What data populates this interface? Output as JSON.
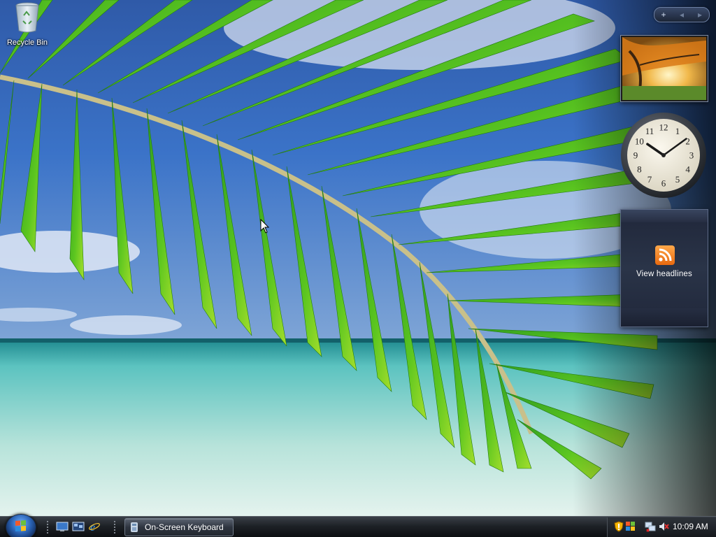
{
  "desktop": {
    "icons": [
      {
        "label": "Recycle Bin",
        "icon": "recycle-bin-icon"
      }
    ]
  },
  "sidebar": {
    "controls": {
      "add": "+",
      "prev": "◂",
      "next": "▸"
    },
    "gadgets": {
      "slideshow": {
        "icon": "slideshow-autumn-photo"
      },
      "clock": {
        "numerals": [
          "12",
          "1",
          "2",
          "3",
          "4",
          "5",
          "6",
          "7",
          "8",
          "9",
          "10",
          "11"
        ],
        "hour": 10,
        "minute": 9
      },
      "feeds": {
        "label": "View headlines",
        "icon": "rss-icon"
      }
    }
  },
  "taskbar": {
    "start_icon": "windows-logo-icon",
    "quick_launch": [
      "show-desktop-icon",
      "switch-windows-icon",
      "internet-explorer-icon"
    ],
    "tasks": [
      {
        "label": "On-Screen Keyboard",
        "icon": "keyboard-icon"
      }
    ],
    "tray": {
      "icons": [
        "security-shield-icon",
        "windows-update-icon",
        "network-icon",
        "volume-muted-icon"
      ],
      "time": "10:09 AM"
    }
  },
  "colors": {
    "taskbar": "#1d2126",
    "accent": "#2a62b4",
    "rss": "#e8690f"
  }
}
